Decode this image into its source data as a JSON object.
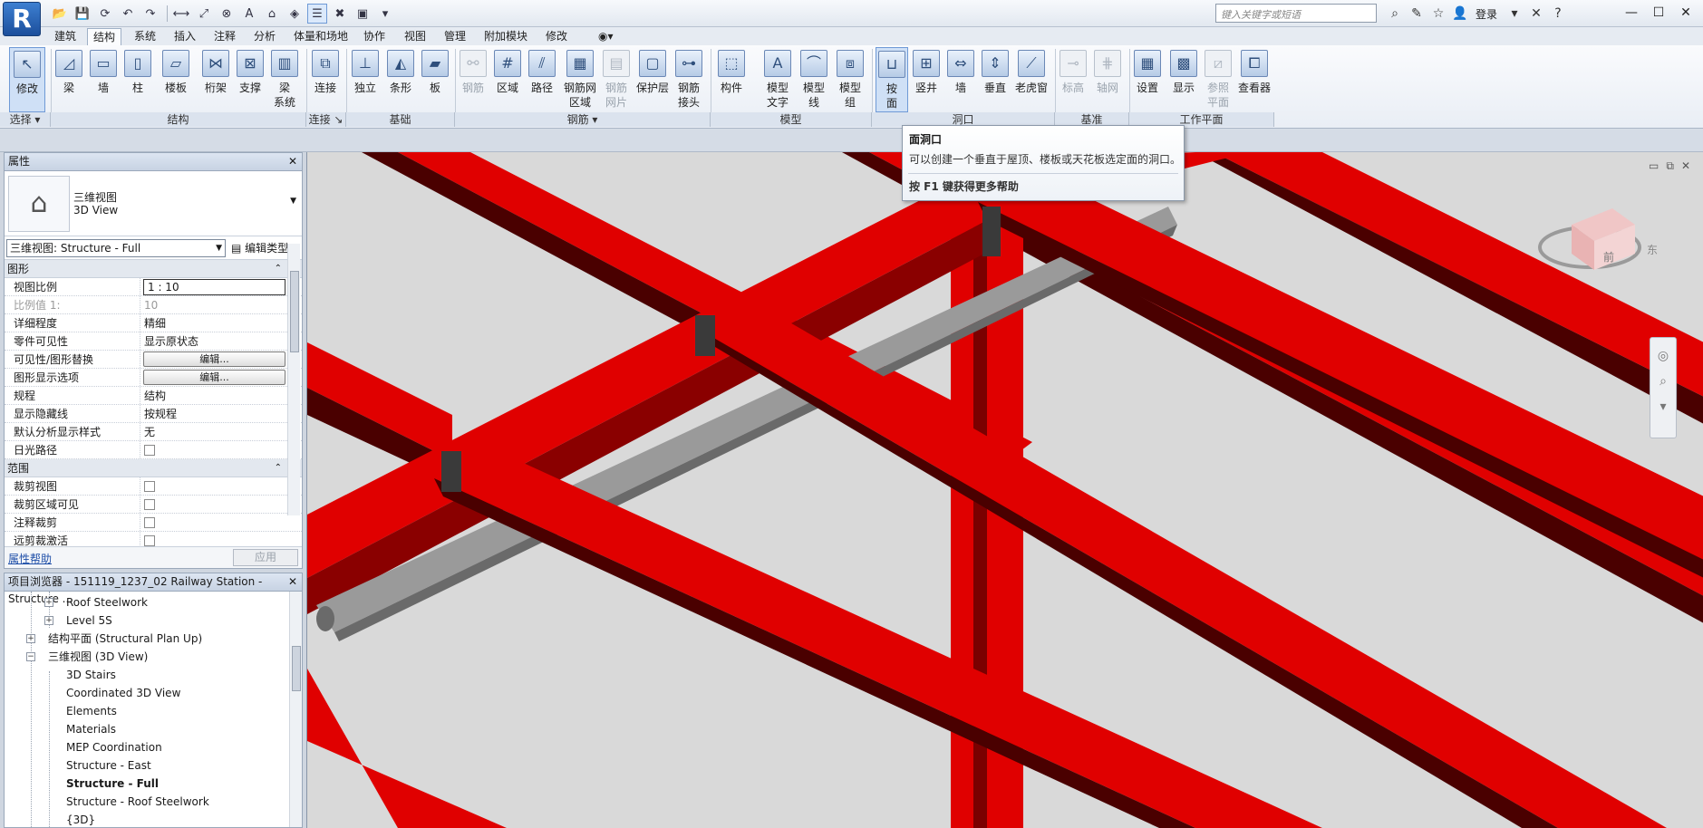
{
  "app": {
    "logo": "R"
  },
  "search": {
    "placeholder": "键入关键字或短语"
  },
  "user": {
    "login": "登录"
  },
  "tabs": [
    "建筑",
    "结构",
    "系统",
    "插入",
    "注释",
    "分析",
    "体量和场地",
    "协作",
    "视图",
    "管理",
    "附加模块",
    "修改"
  ],
  "ribbon": {
    "buttons": [
      {
        "label": "修改",
        "icon": "pointer-icon"
      },
      {
        "label": "梁",
        "icon": "beam-icon"
      },
      {
        "label": "墙",
        "icon": "wall-icon"
      },
      {
        "label": "柱",
        "icon": "column-icon"
      },
      {
        "label": "楼板",
        "icon": "floor-icon"
      },
      {
        "label": "桁架",
        "icon": "truss-icon"
      },
      {
        "label": "支撑",
        "icon": "brace-icon"
      },
      {
        "label": "梁\n系统",
        "icon": "beam-system-icon"
      },
      {
        "label": "连接",
        "icon": "connection-icon"
      },
      {
        "label": "独立",
        "icon": "isolated-foundation-icon"
      },
      {
        "label": "条形",
        "icon": "strip-foundation-icon"
      },
      {
        "label": "板",
        "icon": "slab-icon"
      },
      {
        "label": "钢筋",
        "icon": "rebar-icon"
      },
      {
        "label": "区域",
        "icon": "area-rebar-icon"
      },
      {
        "label": "路径",
        "icon": "path-rebar-icon"
      },
      {
        "label": "钢筋网\n区域",
        "icon": "fabric-area-icon"
      },
      {
        "label": "钢筋\n网片",
        "icon": "fabric-sheet-icon"
      },
      {
        "label": "保护层",
        "icon": "cover-icon"
      },
      {
        "label": "钢筋\n接头",
        "icon": "coupler-icon"
      },
      {
        "label": "构件",
        "icon": "component-icon"
      },
      {
        "label": "模型\n文字",
        "icon": "model-text-icon"
      },
      {
        "label": "模型\n线",
        "icon": "model-line-icon"
      },
      {
        "label": "模型\n组",
        "icon": "model-group-icon"
      },
      {
        "label": "按\n面",
        "icon": "by-face-icon"
      },
      {
        "label": "竖井",
        "icon": "shaft-icon"
      },
      {
        "label": "墙",
        "icon": "wall-opening-icon"
      },
      {
        "label": "垂直",
        "icon": "vertical-opening-icon"
      },
      {
        "label": "老虎窗",
        "icon": "dormer-icon"
      },
      {
        "label": "标高",
        "icon": "level-icon"
      },
      {
        "label": "轴网",
        "icon": "grid-icon"
      },
      {
        "label": "设置",
        "icon": "set-workplane-icon"
      },
      {
        "label": "显示",
        "icon": "show-workplane-icon"
      },
      {
        "label": "参照\n平面",
        "icon": "ref-plane-icon"
      },
      {
        "label": "查看器",
        "icon": "viewer-icon"
      }
    ],
    "panels": [
      "选择 ▾",
      "结构",
      "连接 ↘",
      "基础",
      "钢筋 ▾",
      "模型",
      "洞口",
      "基准",
      "工作平面"
    ]
  },
  "tooltip": {
    "title": "面洞口",
    "description": "可以创建一个垂直于屋顶、楼板或天花板选定面的洞口。",
    "help": "按 F1 键获得更多帮助"
  },
  "properties": {
    "title": "属性",
    "type_line1": "三维视图",
    "type_line2": "3D View",
    "view_selector": "三维视图: Structure - Full",
    "edit_type": "编辑类型",
    "groups": [
      {
        "name": "图形",
        "rows": [
          {
            "key": "视图比例",
            "value": "1 : 10"
          },
          {
            "key": "比例值 1:",
            "value": "10"
          },
          {
            "key": "详细程度",
            "value": "精细"
          },
          {
            "key": "零件可见性",
            "value": "显示原状态"
          },
          {
            "key": "可见性/图形替换",
            "value": "编辑..."
          },
          {
            "key": "图形显示选项",
            "value": "编辑..."
          },
          {
            "key": "规程",
            "value": "结构"
          },
          {
            "key": "显示隐藏线",
            "value": "按规程"
          },
          {
            "key": "默认分析显示样式",
            "value": "无"
          },
          {
            "key": "日光路径",
            "value": ""
          }
        ]
      },
      {
        "name": "范围",
        "rows": [
          {
            "key": "裁剪视图",
            "value": ""
          },
          {
            "key": "裁剪区域可见",
            "value": ""
          },
          {
            "key": "注释裁剪",
            "value": ""
          },
          {
            "key": "远剪裁激活",
            "value": ""
          }
        ]
      }
    ],
    "help_link": "属性帮助",
    "apply": "应用"
  },
  "browser": {
    "title": "项目浏览器 - 151119_1237_02 Railway Station - Structure ...",
    "items": [
      {
        "label": "Roof Steelwork",
        "level": 2,
        "expand": "+"
      },
      {
        "label": "Level 5S",
        "level": 2,
        "expand": "+"
      },
      {
        "label": "结构平面 (Structural Plan Up)",
        "level": 1,
        "expand": "+"
      },
      {
        "label": "三维视图 (3D View)",
        "level": 1,
        "expand": "−"
      },
      {
        "label": "3D Stairs",
        "level": 2
      },
      {
        "label": "Coordinated 3D View",
        "level": 2
      },
      {
        "label": "Elements",
        "level": 2
      },
      {
        "label": "Materials",
        "level": 2
      },
      {
        "label": "MEP Coordination",
        "level": 2
      },
      {
        "label": "Structure - East",
        "level": 2
      },
      {
        "label": "Structure - Full",
        "level": 2,
        "bold": true
      },
      {
        "label": "Structure - Roof Steelwork",
        "level": 2
      },
      {
        "label": "{3D}",
        "level": 2
      }
    ]
  },
  "viewcube": {
    "face": "前",
    "side": "东"
  },
  "colors": {
    "steel": "#e00000",
    "steel_dark": "#4a0000",
    "pipe": "#9a9a9a",
    "canvas": "#d9d9d9"
  }
}
